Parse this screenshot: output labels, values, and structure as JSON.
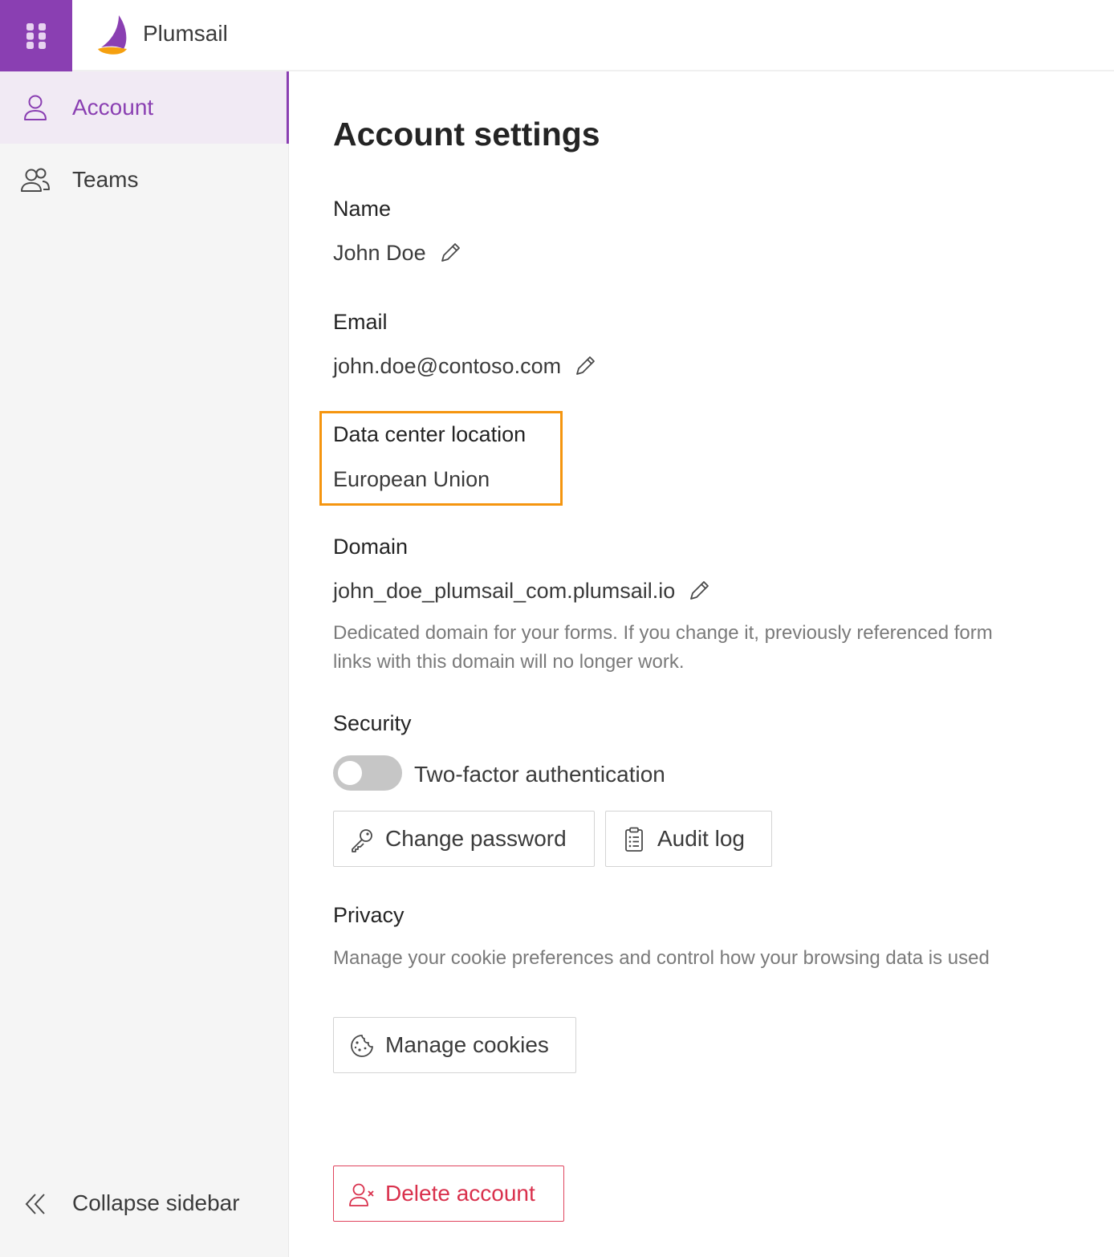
{
  "header": {
    "brand": "Plumsail"
  },
  "sidebar": {
    "items": [
      {
        "label": "Account",
        "icon": "person-icon",
        "active": true
      },
      {
        "label": "Teams",
        "icon": "people-icon",
        "active": false
      }
    ],
    "collapse_label": "Collapse sidebar"
  },
  "main": {
    "title": "Account settings",
    "name": {
      "label": "Name",
      "value": "John Doe"
    },
    "email": {
      "label": "Email",
      "value": "john.doe@contoso.com"
    },
    "data_center": {
      "label": "Data center location",
      "value": "European Union"
    },
    "domain": {
      "label": "Domain",
      "value": "john_doe_plumsail_com.plumsail.io",
      "hint": "Dedicated domain for your forms. If you change it, previously referenced form links with this domain will no longer work."
    },
    "security": {
      "label": "Security",
      "two_factor_label": "Two-factor authentication",
      "two_factor_enabled": false,
      "change_password_label": "Change password",
      "audit_log_label": "Audit log"
    },
    "privacy": {
      "label": "Privacy",
      "hint": "Manage your cookie preferences and control how your browsing data is used",
      "manage_cookies_label": "Manage cookies"
    },
    "delete_account_label": "Delete account"
  },
  "colors": {
    "accent": "#8a3fb2",
    "highlight": "#f5950f",
    "danger": "#d9304c",
    "logo_orange": "#f5a00f"
  }
}
